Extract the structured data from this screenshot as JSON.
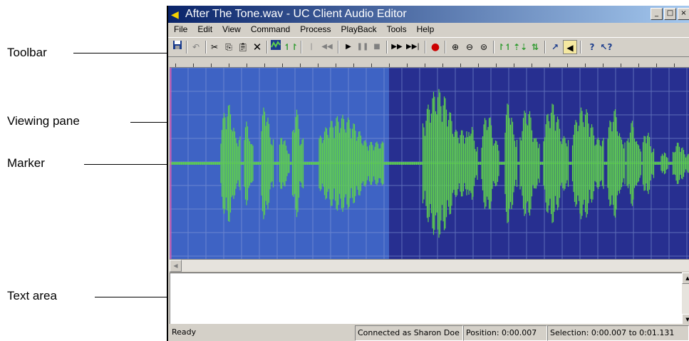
{
  "callouts": {
    "toolbar": "Toolbar",
    "viewing_pane": "Viewing pane",
    "marker": "Marker",
    "text_area": "Text area"
  },
  "window": {
    "title": "After The Tone.wav - UC Client Audio Editor",
    "minimize_label": "_",
    "maximize_label": "□",
    "close_label": "×"
  },
  "menu": [
    "File",
    "Edit",
    "View",
    "Command",
    "Process",
    "PlayBack",
    "Tools",
    "Help"
  ],
  "toolbar_icons": [
    "save-icon",
    "undo-icon",
    "cut-icon",
    "copy-icon",
    "paste-icon",
    "delete-icon",
    "waveform-view-icon",
    "pitch-icon",
    "skip-start-icon",
    "rewind-icon",
    "play-icon",
    "pause-icon",
    "stop-icon",
    "fast-forward-icon",
    "skip-end-icon",
    "record-icon",
    "zoom-in-icon",
    "zoom-out-icon",
    "zoom-fit-icon",
    "amplify-icon",
    "normalize-icon",
    "fade-icon",
    "pen-icon",
    "speaker-icon",
    "help-icon",
    "context-help-icon"
  ],
  "status": {
    "ready": "Ready",
    "connection": "Connected as Sharon Doe",
    "position": "Position: 0:00.007",
    "selection": "Selection: 0:00.007 to 0:01.131"
  },
  "colors": {
    "selected_bg": "#3e63c4",
    "unselected_bg": "#272f90",
    "waveform": "#5ecf4e",
    "marker": "#d060b0",
    "grid": "#8da0d8"
  }
}
